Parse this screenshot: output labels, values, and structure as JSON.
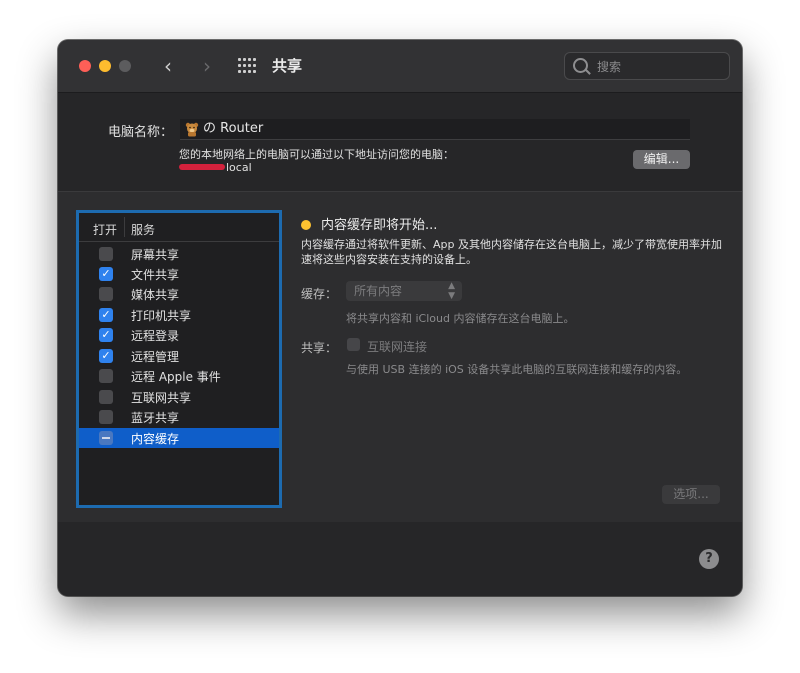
{
  "window": {
    "title": "共享",
    "search": {
      "placeholder": "搜索",
      "value": ""
    }
  },
  "computer": {
    "name_label": "电脑名称：",
    "name_value": "の Router",
    "address_description": "您的本地网络上的电脑可以通过以下地址访问您的电脑：",
    "address_suffix": "local",
    "edit_label": "编辑..."
  },
  "services": {
    "header_open": "打开",
    "header_service": "服务",
    "items": [
      {
        "label": "屏幕共享",
        "state": "unchecked"
      },
      {
        "label": "文件共享",
        "state": "checked"
      },
      {
        "label": "媒体共享",
        "state": "unchecked"
      },
      {
        "label": "打印机共享",
        "state": "checked"
      },
      {
        "label": "远程登录",
        "state": "checked"
      },
      {
        "label": "远程管理",
        "state": "checked"
      },
      {
        "label": "远程 Apple 事件",
        "state": "unchecked"
      },
      {
        "label": "互联网共享",
        "state": "unchecked"
      },
      {
        "label": "蓝牙共享",
        "state": "unchecked"
      },
      {
        "label": "内容缓存",
        "state": "mixed",
        "selected": true
      }
    ]
  },
  "detail": {
    "status_title": "内容缓存即将开始...",
    "status_color": "#fec230",
    "description": "内容缓存通过将软件更新、App 及其他内容储存在这台电脑上，减少了带宽使用率并加速将这些内容安装在支持的设备上。",
    "cache_label": "缓存：",
    "cache_value": "所有内容",
    "cache_hint": "将共享内容和 iCloud 内容储存在这台电脑上。",
    "share_label": "共享：",
    "share_option": "互联网连接",
    "share_hint": "与使用 USB 连接的 iOS 设备共享此电脑的互联网连接和缓存的内容。",
    "options_label": "选项..."
  },
  "help_label": "?",
  "accent_color": "#2f82ee",
  "selection_color": "#0f5ec9"
}
